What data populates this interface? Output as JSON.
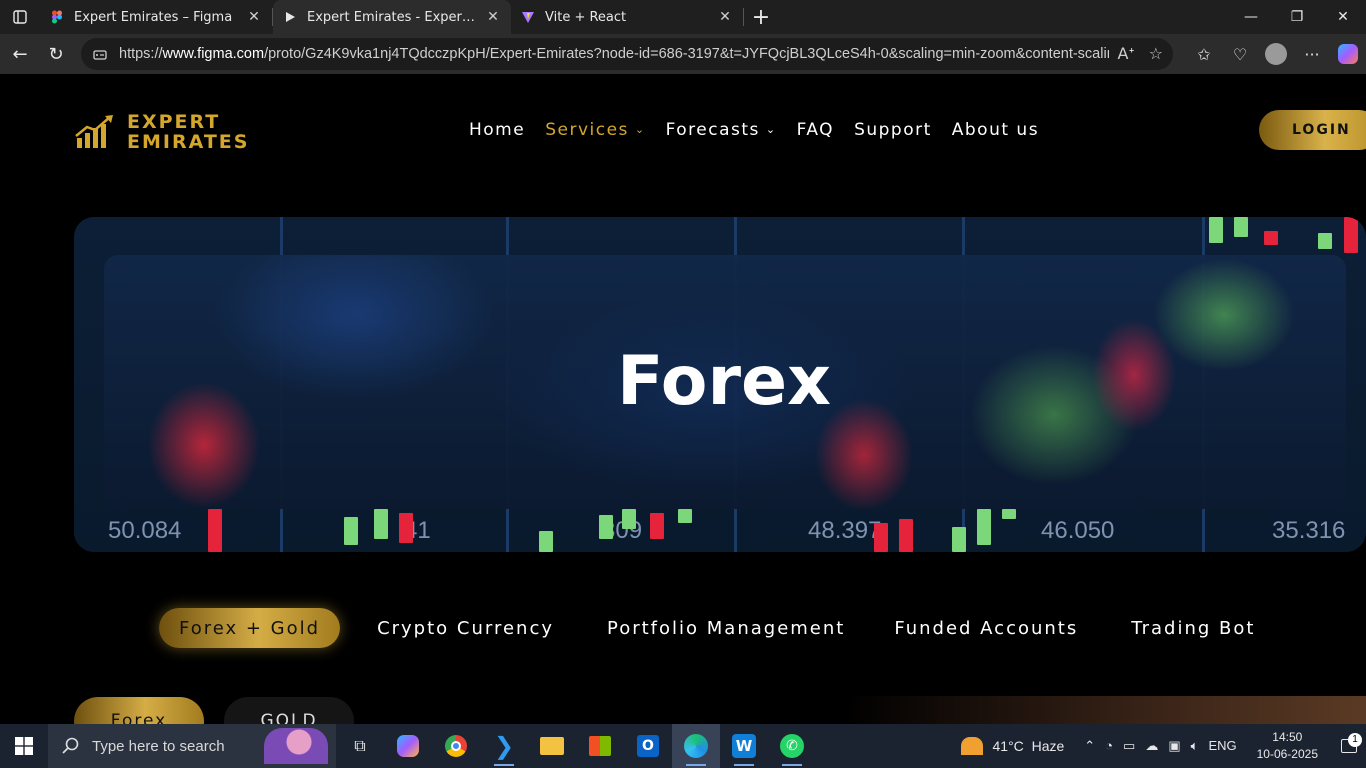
{
  "browser": {
    "tabs": [
      {
        "title": "Expert Emirates – Figma",
        "icon": "figma-icon",
        "active": false
      },
      {
        "title": "Expert Emirates - Expert Emirates",
        "icon": "play-icon",
        "active": true
      },
      {
        "title": "Vite + React",
        "icon": "vite-icon",
        "active": false
      }
    ],
    "url_prefix": "https://",
    "url_domain": "www.figma.com",
    "url_path": "/proto/Gz4K9vka1nj4TQdcczpKpH/Expert-Emirates?node-id=686-3197&t=JYFQcjBL3QLceS4h-0&scaling=min-zoom&content-scaling=..."
  },
  "site": {
    "logo_line1": "EXPERT",
    "logo_line2": "EMIRATES",
    "nav": [
      {
        "label": "Home",
        "active": false,
        "dropdown": false
      },
      {
        "label": "Services",
        "active": true,
        "dropdown": true
      },
      {
        "label": "Forecasts",
        "active": false,
        "dropdown": true
      },
      {
        "label": "FAQ",
        "active": false,
        "dropdown": false
      },
      {
        "label": "Support",
        "active": false,
        "dropdown": false
      },
      {
        "label": "About us",
        "active": false,
        "dropdown": false
      }
    ],
    "login_label": "LOGIN",
    "hero_title": "Forex",
    "hero_tickers": [
      "50.084",
      "41",
      "309",
      "48.397",
      "46.050",
      "35.316"
    ],
    "filters": [
      "Forex + Gold",
      "Crypto Currency",
      "Portfolio Management",
      "Funded Accounts",
      "Trading Bot"
    ],
    "sub_tabs": [
      "Forex",
      "GOLD"
    ],
    "accent_color": "#d4a72c"
  },
  "taskbar": {
    "search_placeholder": "Type here to search",
    "apps": [
      "task-view-icon",
      "copilot-icon",
      "chrome-icon",
      "vscode-icon",
      "file-explorer-icon",
      "store-icon",
      "outlook-icon",
      "edge-icon",
      "w-app-icon",
      "whatsapp-icon"
    ],
    "weather_temp": "41°C",
    "weather_desc": "Haze",
    "language": "ENG",
    "time": "14:50",
    "date": "10-06-2025",
    "notification_count": "1"
  }
}
